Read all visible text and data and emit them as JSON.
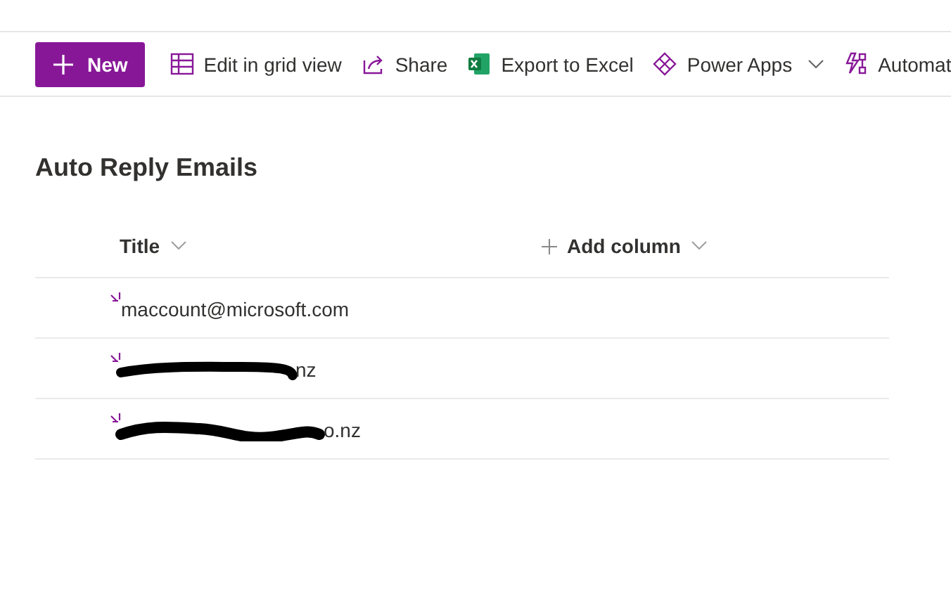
{
  "toolbar": {
    "new_button": "New",
    "items": [
      {
        "kind": "grid",
        "label": "Edit in grid view",
        "dropdown": false
      },
      {
        "kind": "share",
        "label": "Share",
        "dropdown": false
      },
      {
        "kind": "excel",
        "label": "Export to Excel",
        "dropdown": false
      },
      {
        "kind": "powerapps",
        "label": "Power Apps",
        "dropdown": true
      },
      {
        "kind": "automate",
        "label": "Automat",
        "dropdown": false
      }
    ]
  },
  "list": {
    "title": "Auto Reply Emails",
    "columns": [
      {
        "kind": "title",
        "label": "Title"
      },
      {
        "kind": "add",
        "label": "Add column"
      }
    ],
    "rows": [
      {
        "title": "maccount@microsoft.com",
        "redacted": false,
        "new": true
      },
      {
        "title": "nz",
        "redacted": true,
        "new": true
      },
      {
        "title": "o.nz",
        "redacted": true,
        "new": true
      }
    ]
  }
}
